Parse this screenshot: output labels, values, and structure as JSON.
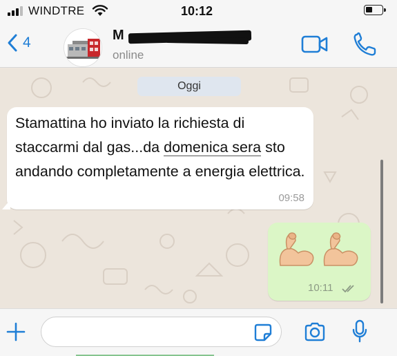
{
  "status_bar": {
    "carrier": "WINDTRE",
    "time": "10:12",
    "signal_bars_filled": 3,
    "signal_bars_total": 4
  },
  "header": {
    "back_count": "4",
    "contact_name": "M",
    "presence": "online",
    "accent_color": "#1f7ed6"
  },
  "chat": {
    "date_label": "Oggi",
    "incoming": {
      "text_part1": "Stamattina ho inviato la richiesta di staccarmi dal gas...da ",
      "text_underlined": "domenica sera",
      "text_part2": " sto andando completamente a energia elettrica.",
      "time": "09:58"
    },
    "outgoing": {
      "emojis": [
        "flexed-biceps",
        "flexed-biceps"
      ],
      "time": "10:11",
      "status": "read-ticks"
    }
  },
  "input_bar": {
    "value": "",
    "placeholder": ""
  },
  "icons": {
    "back": "chevron-left-icon",
    "video": "video-camera-icon",
    "call": "phone-icon",
    "plus": "plus-icon",
    "sticker": "sticker-icon",
    "camera": "camera-icon",
    "mic": "microphone-icon"
  }
}
